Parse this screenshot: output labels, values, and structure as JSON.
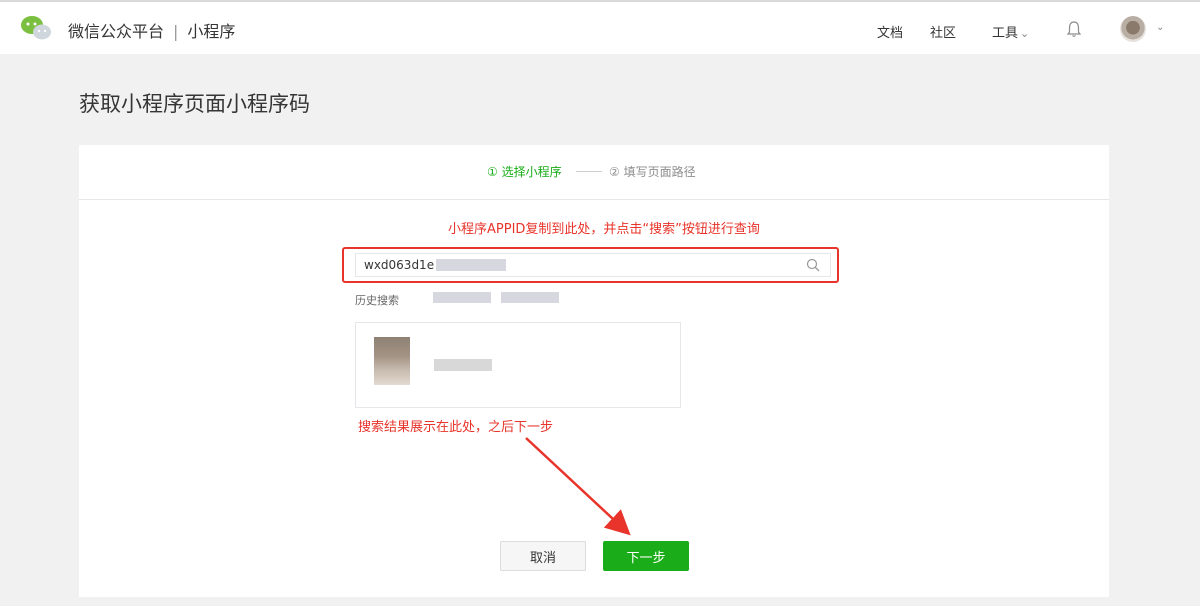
{
  "header": {
    "brand_name": "微信公众平台",
    "separator": "|",
    "section": "小程序",
    "nav": [
      "文档",
      "社区",
      "工具"
    ],
    "tools_chevron": "⌄",
    "avatar_chevron": "⌄"
  },
  "page": {
    "title": "获取小程序页面小程序码"
  },
  "steps": [
    {
      "number": "①",
      "label": "选择小程序",
      "active": true
    },
    {
      "number": "②",
      "label": "填写页面路径",
      "active": false
    }
  ],
  "annotations": {
    "search_hint": "小程序APPID复制到此处，并点击“搜索”按钮进行查询",
    "result_hint": "搜索结果展示在此处，之后下一步"
  },
  "search": {
    "value": "wxd063d1e"
  },
  "history": {
    "label": "历史搜索"
  },
  "buttons": {
    "cancel": "取消",
    "next": "下一步"
  },
  "colors": {
    "accent_green": "#1aad19",
    "annotation_red": "#e8342a",
    "page_bg": "#f1f1f1"
  }
}
